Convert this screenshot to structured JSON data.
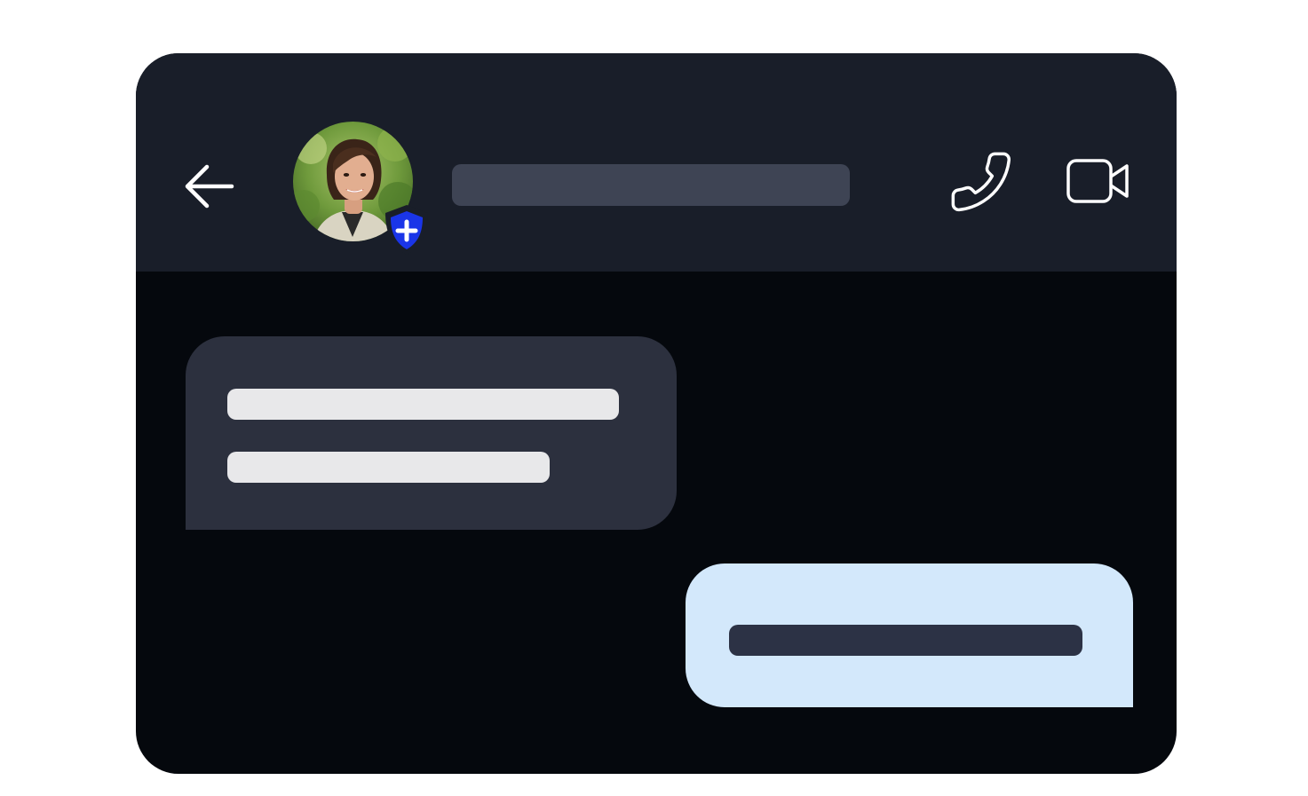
{
  "app": {
    "name": "chat-conversation-mockup"
  },
  "header": {
    "back_icon": "arrow-left-icon",
    "avatar": "contact-avatar-photo",
    "badge_icon": "shield-plus-icon",
    "call_icon": "phone-icon",
    "video_icon": "video-camera-icon"
  },
  "messages": [
    {
      "direction": "incoming",
      "lines": 2
    },
    {
      "direction": "outgoing",
      "lines": 1
    }
  ],
  "colors": {
    "page_background": "#ffffff",
    "header_background": "#191e29",
    "chat_background": "#05080d",
    "incoming_bubble": "#2c303e",
    "outgoing_bubble": "#d3e8fb",
    "placeholder": "#3e4454",
    "badge_blue": "#1a35e8"
  }
}
